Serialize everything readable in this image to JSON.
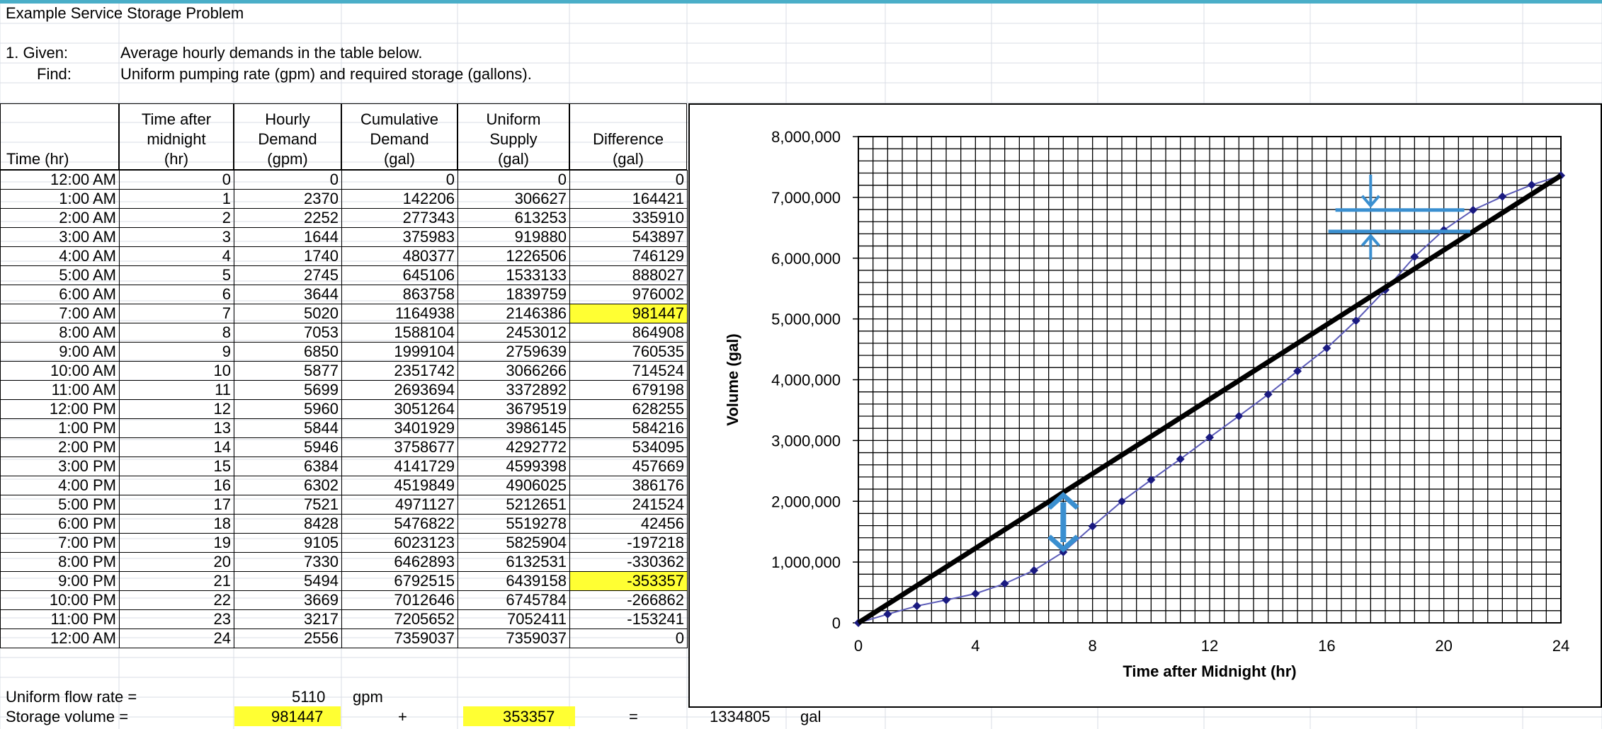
{
  "title": "Example Service Storage Problem",
  "given_label": "1.  Given:",
  "given_text": "Average hourly demands in the table below.",
  "find_label": "Find:",
  "find_text": "Uniform pumping rate (gpm) and required storage (gallons).",
  "table": {
    "headers": [
      {
        "lines": [
          "Time (hr)"
        ]
      },
      {
        "lines": [
          "Time after",
          "midnight",
          "(hr)"
        ]
      },
      {
        "lines": [
          "Hourly",
          "Demand",
          "(gpm)"
        ]
      },
      {
        "lines": [
          "Cumulative",
          "Demand",
          "(gal)"
        ]
      },
      {
        "lines": [
          "Uniform",
          "Supply",
          "(gal)"
        ]
      },
      {
        "lines": [
          "Difference",
          "(gal)"
        ]
      }
    ],
    "rows": [
      [
        "12:00 AM",
        "0",
        "0",
        "0",
        "0",
        "0"
      ],
      [
        "1:00 AM",
        "1",
        "2370",
        "142206",
        "306627",
        "164421"
      ],
      [
        "2:00 AM",
        "2",
        "2252",
        "277343",
        "613253",
        "335910"
      ],
      [
        "3:00 AM",
        "3",
        "1644",
        "375983",
        "919880",
        "543897"
      ],
      [
        "4:00 AM",
        "4",
        "1740",
        "480377",
        "1226506",
        "746129"
      ],
      [
        "5:00 AM",
        "5",
        "2745",
        "645106",
        "1533133",
        "888027"
      ],
      [
        "6:00 AM",
        "6",
        "3644",
        "863758",
        "1839759",
        "976002"
      ],
      [
        "7:00 AM",
        "7",
        "5020",
        "1164938",
        "2146386",
        "981447"
      ],
      [
        "8:00 AM",
        "8",
        "7053",
        "1588104",
        "2453012",
        "864908"
      ],
      [
        "9:00 AM",
        "9",
        "6850",
        "1999104",
        "2759639",
        "760535"
      ],
      [
        "10:00 AM",
        "10",
        "5877",
        "2351742",
        "3066266",
        "714524"
      ],
      [
        "11:00 AM",
        "11",
        "5699",
        "2693694",
        "3372892",
        "679198"
      ],
      [
        "12:00 PM",
        "12",
        "5960",
        "3051264",
        "3679519",
        "628255"
      ],
      [
        "1:00 PM",
        "13",
        "5844",
        "3401929",
        "3986145",
        "584216"
      ],
      [
        "2:00 PM",
        "14",
        "5946",
        "3758677",
        "4292772",
        "534095"
      ],
      [
        "3:00 PM",
        "15",
        "6384",
        "4141729",
        "4599398",
        "457669"
      ],
      [
        "4:00 PM",
        "16",
        "6302",
        "4519849",
        "4906025",
        "386176"
      ],
      [
        "5:00 PM",
        "17",
        "7521",
        "4971127",
        "5212651",
        "241524"
      ],
      [
        "6:00 PM",
        "18",
        "8428",
        "5476822",
        "5519278",
        "42456"
      ],
      [
        "7:00 PM",
        "19",
        "9105",
        "6023123",
        "5825904",
        "-197218"
      ],
      [
        "8:00 PM",
        "20",
        "7330",
        "6462893",
        "6132531",
        "-330362"
      ],
      [
        "9:00 PM",
        "21",
        "5494",
        "6792515",
        "6439158",
        "-353357"
      ],
      [
        "10:00 PM",
        "22",
        "3669",
        "7012646",
        "6745784",
        "-266862"
      ],
      [
        "11:00 PM",
        "23",
        "3217",
        "7205652",
        "7052411",
        "-153241"
      ],
      [
        "12:00 AM",
        "24",
        "2556",
        "7359037",
        "7359037",
        "0"
      ]
    ],
    "highlight_color": "#ffff33"
  },
  "summary": {
    "flow_label": "Uniform flow rate =",
    "flow_value": "5110",
    "flow_unit": "gpm",
    "storage_label": "Storage volume =",
    "storage_a": "981447",
    "plus": "+",
    "storage_b": "353357",
    "equals": "=",
    "storage_total": "1334805",
    "storage_unit": "gal"
  },
  "chart_data": {
    "type": "line",
    "xlabel": "Time after Midnight (hr)",
    "ylabel": "Volume (gal)",
    "xlim": [
      0,
      24
    ],
    "ylim": [
      0,
      8000000
    ],
    "x_ticks": [
      "0",
      "4",
      "8",
      "12",
      "16",
      "20",
      "24"
    ],
    "y_ticks": [
      "0",
      "1,000,000",
      "2,000,000",
      "3,000,000",
      "4,000,000",
      "5,000,000",
      "6,000,000",
      "7,000,000",
      "8,000,000"
    ],
    "grid": true,
    "series": [
      {
        "x": [
          0,
          1,
          2,
          3,
          4,
          5,
          6,
          7,
          8,
          9,
          10,
          11,
          12,
          13,
          14,
          15,
          16,
          17,
          18,
          19,
          20,
          21,
          22,
          23,
          24
        ],
        "y": [
          0,
          142206,
          277343,
          375983,
          480377,
          645106,
          863758,
          1164938,
          1588104,
          1999104,
          2351742,
          2693694,
          3051264,
          3401929,
          3758677,
          4141729,
          4519849,
          4971127,
          5476822,
          6023123,
          6462893,
          6792515,
          7012646,
          7205652,
          7359037
        ],
        "color": "#5b5bb8",
        "marker_color": "#1a1a80"
      },
      {
        "x": [
          0,
          24
        ],
        "y": [
          0,
          7359037
        ],
        "color": "#000000"
      }
    ],
    "arrow_color": "#3a8fd0"
  }
}
